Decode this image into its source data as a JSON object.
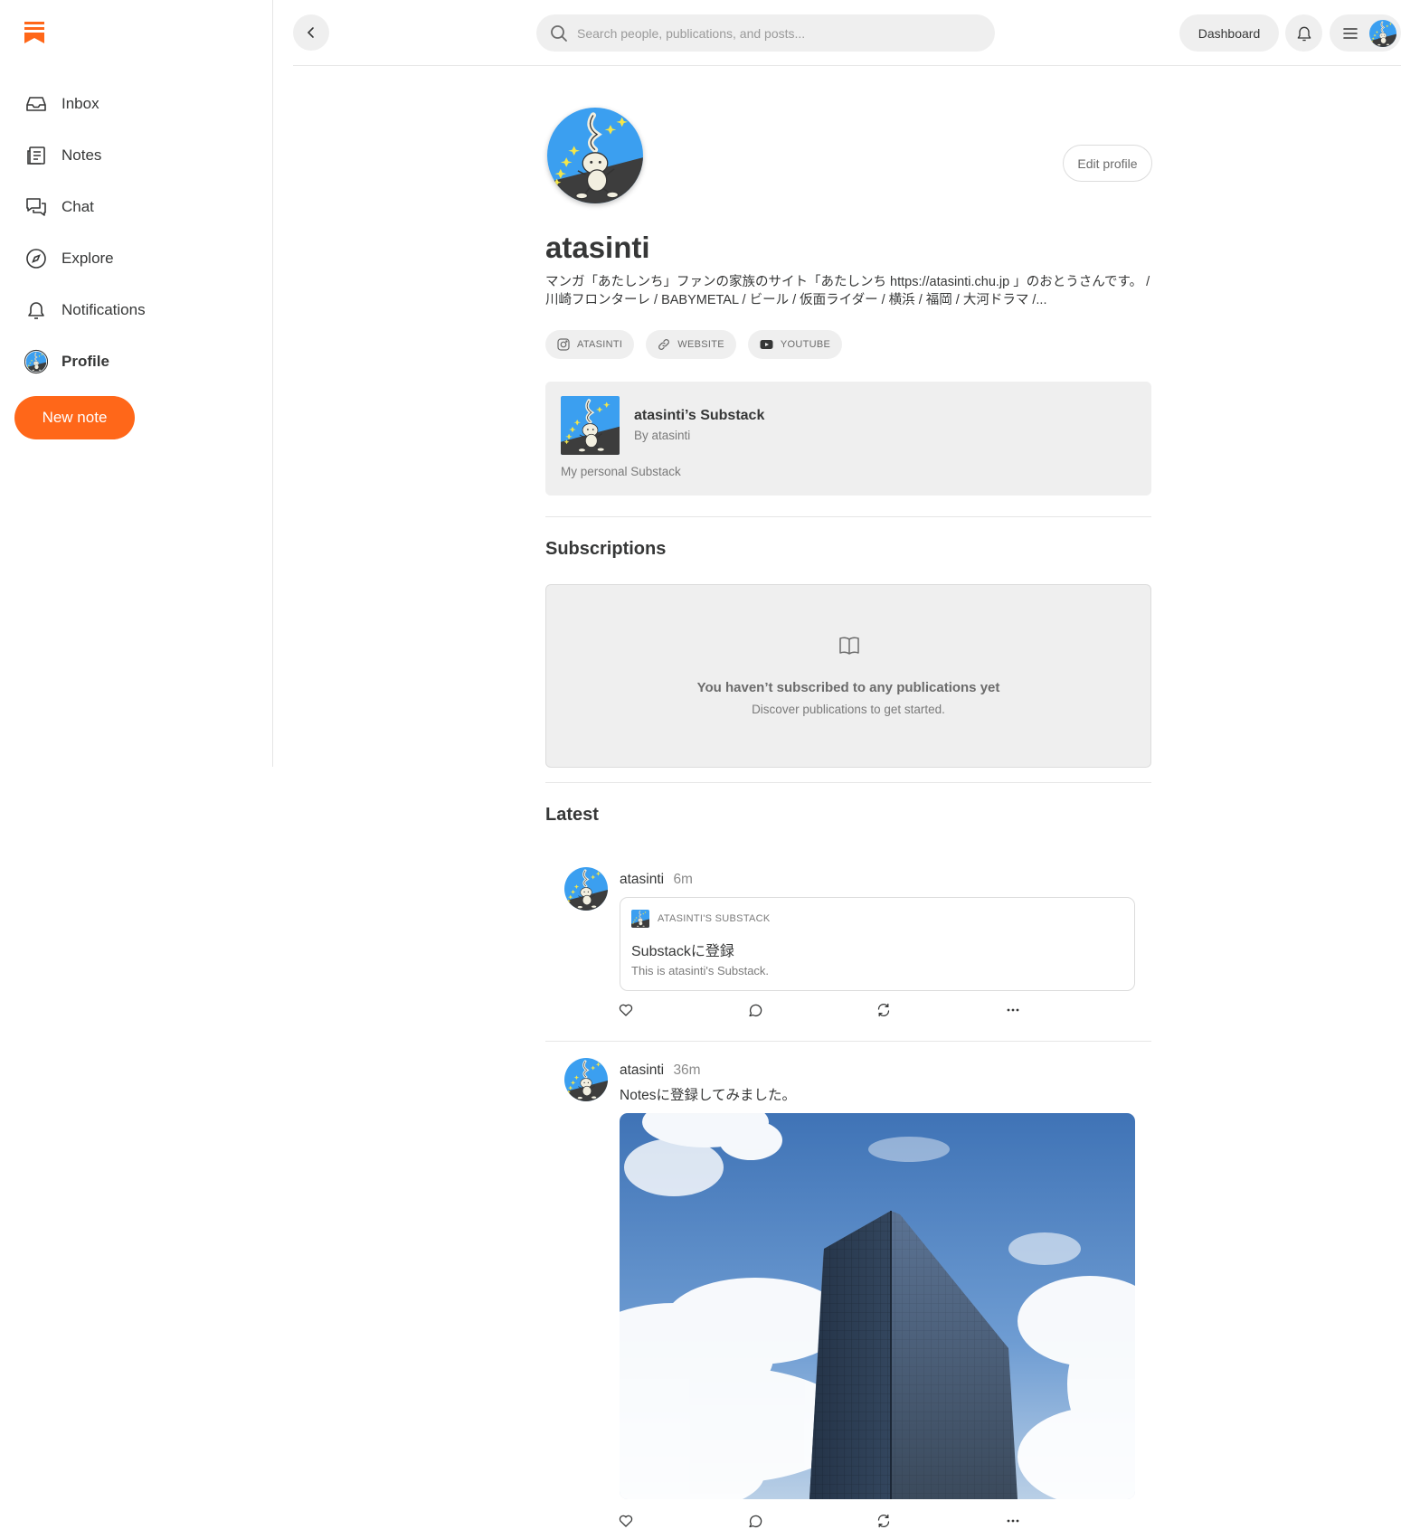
{
  "sidebar": {
    "items": [
      {
        "label": "Inbox",
        "icon": "inbox-icon"
      },
      {
        "label": "Notes",
        "icon": "notes-icon"
      },
      {
        "label": "Chat",
        "icon": "chat-icon"
      },
      {
        "label": "Explore",
        "icon": "compass-icon"
      },
      {
        "label": "Notifications",
        "icon": "bell-icon"
      },
      {
        "label": "Profile",
        "icon": "avatar",
        "active": true
      }
    ],
    "new_note_label": "New note"
  },
  "topbar": {
    "search_placeholder": "Search people, publications, and posts...",
    "dashboard_label": "Dashboard"
  },
  "profile": {
    "name": "atasinti",
    "edit_label": "Edit profile",
    "bio": "マンガ「あたしンち」ファンの家族のサイト「あたしンち https://atasinti.chu.jp 」のおとうさんです。 / 川崎フロンターレ / BABYMETAL / ビール / 仮面ライダー / 横浜 / 福岡 / 大河ドラマ /...",
    "links": [
      {
        "label": "ATASINTI",
        "icon": "instagram-icon"
      },
      {
        "label": "WEBSITE",
        "icon": "link-icon"
      },
      {
        "label": "YOUTUBE",
        "icon": "youtube-icon"
      }
    ]
  },
  "publication": {
    "title": "atasinti’s Substack",
    "byline": "By atasinti",
    "description": "My personal Substack"
  },
  "subscriptions": {
    "heading": "Subscriptions",
    "empty_title": "You haven’t subscribed to any publications yet",
    "empty_subtitle": "Discover publications to get started."
  },
  "latest": {
    "heading": "Latest",
    "notes": [
      {
        "author": "atasinti",
        "time": "6m",
        "embed": {
          "publication": "ATASINTI'S SUBSTACK",
          "title": "Substackに登録",
          "subtitle": "This is atasinti's Substack."
        }
      },
      {
        "author": "atasinti",
        "time": "36m",
        "text": "Notesに登録してみました。",
        "image": "photo of glass office tower against blue sky with clouds"
      }
    ]
  },
  "colors": {
    "accent": "#ff6719",
    "surface": "#efefef",
    "text": "#363737",
    "muted": "#7a7a7a",
    "avatar_sky": "#3b9ff0",
    "avatar_ground": "#3d3d3d"
  }
}
